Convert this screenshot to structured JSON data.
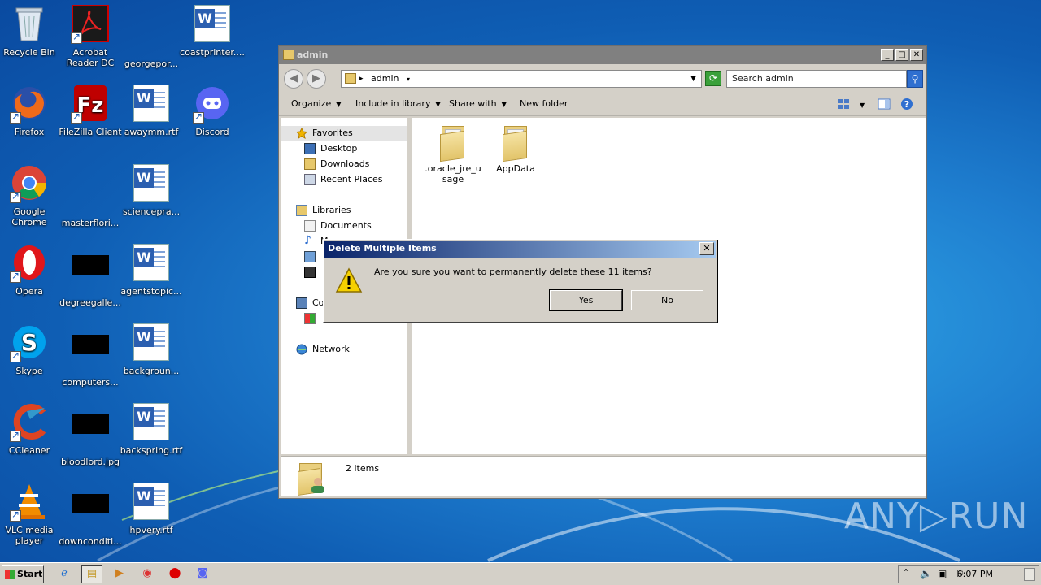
{
  "desktop": {
    "icons": [
      {
        "label": "Recycle Bin",
        "icon": "recycle-bin-icon"
      },
      {
        "label": "Acrobat Reader DC",
        "icon": "acrobat-icon"
      },
      {
        "label": "georgepor...",
        "icon": "blank-file-icon"
      },
      {
        "label": "coastprinter....",
        "icon": "word-document-icon"
      },
      {
        "label": "Firefox",
        "icon": "firefox-icon"
      },
      {
        "label": "FileZilla Client",
        "icon": "filezilla-icon"
      },
      {
        "label": "awaymm.rtf",
        "icon": "word-document-icon"
      },
      {
        "label": "Discord",
        "icon": "discord-icon"
      },
      {
        "label": "Google Chrome",
        "icon": "chrome-icon"
      },
      {
        "label": "masterflori...",
        "icon": "blank-file-icon"
      },
      {
        "label": "sciencepra...",
        "icon": "word-document-icon"
      },
      {
        "label": "Opera",
        "icon": "opera-icon"
      },
      {
        "label": "degreegalle...",
        "icon": "image-file-icon"
      },
      {
        "label": "agentstopic...",
        "icon": "word-document-icon"
      },
      {
        "label": "Skype",
        "icon": "skype-icon"
      },
      {
        "label": "computers...",
        "icon": "image-file-icon"
      },
      {
        "label": "backgroun...",
        "icon": "word-document-icon"
      },
      {
        "label": "CCleaner",
        "icon": "ccleaner-icon"
      },
      {
        "label": "bloodlord.jpg",
        "icon": "image-file-icon"
      },
      {
        "label": "backspring.rtf",
        "icon": "word-document-icon"
      },
      {
        "label": "VLC media player",
        "icon": "vlc-icon"
      },
      {
        "label": "downconditi...",
        "icon": "image-file-icon"
      },
      {
        "label": "hpvery.rtf",
        "icon": "word-document-icon"
      }
    ]
  },
  "explorer": {
    "title": "admin",
    "address": {
      "path": "admin"
    },
    "search": {
      "placeholder": "Search admin"
    },
    "toolbar": {
      "organize": "Organize",
      "include": "Include in library",
      "share": "Share with",
      "new_folder": "New folder"
    },
    "nav": {
      "favorites": "Favorites",
      "desktop": "Desktop",
      "downloads": "Downloads",
      "recent": "Recent Places",
      "libraries": "Libraries",
      "documents": "Documents",
      "music_partial": "Mu",
      "computer_partial": "Co",
      "network": "Network"
    },
    "files": [
      {
        "name": ".oracle_jre_usage"
      },
      {
        "name": "AppData"
      }
    ],
    "status": "2 items"
  },
  "dialog": {
    "title": "Delete Multiple Items",
    "message": "Are you sure you want to permanently delete these 11 items?",
    "yes": "Yes",
    "no": "No"
  },
  "taskbar": {
    "start": "Start",
    "clock": "6:07 PM"
  },
  "watermark": "ANY▷RUN"
}
